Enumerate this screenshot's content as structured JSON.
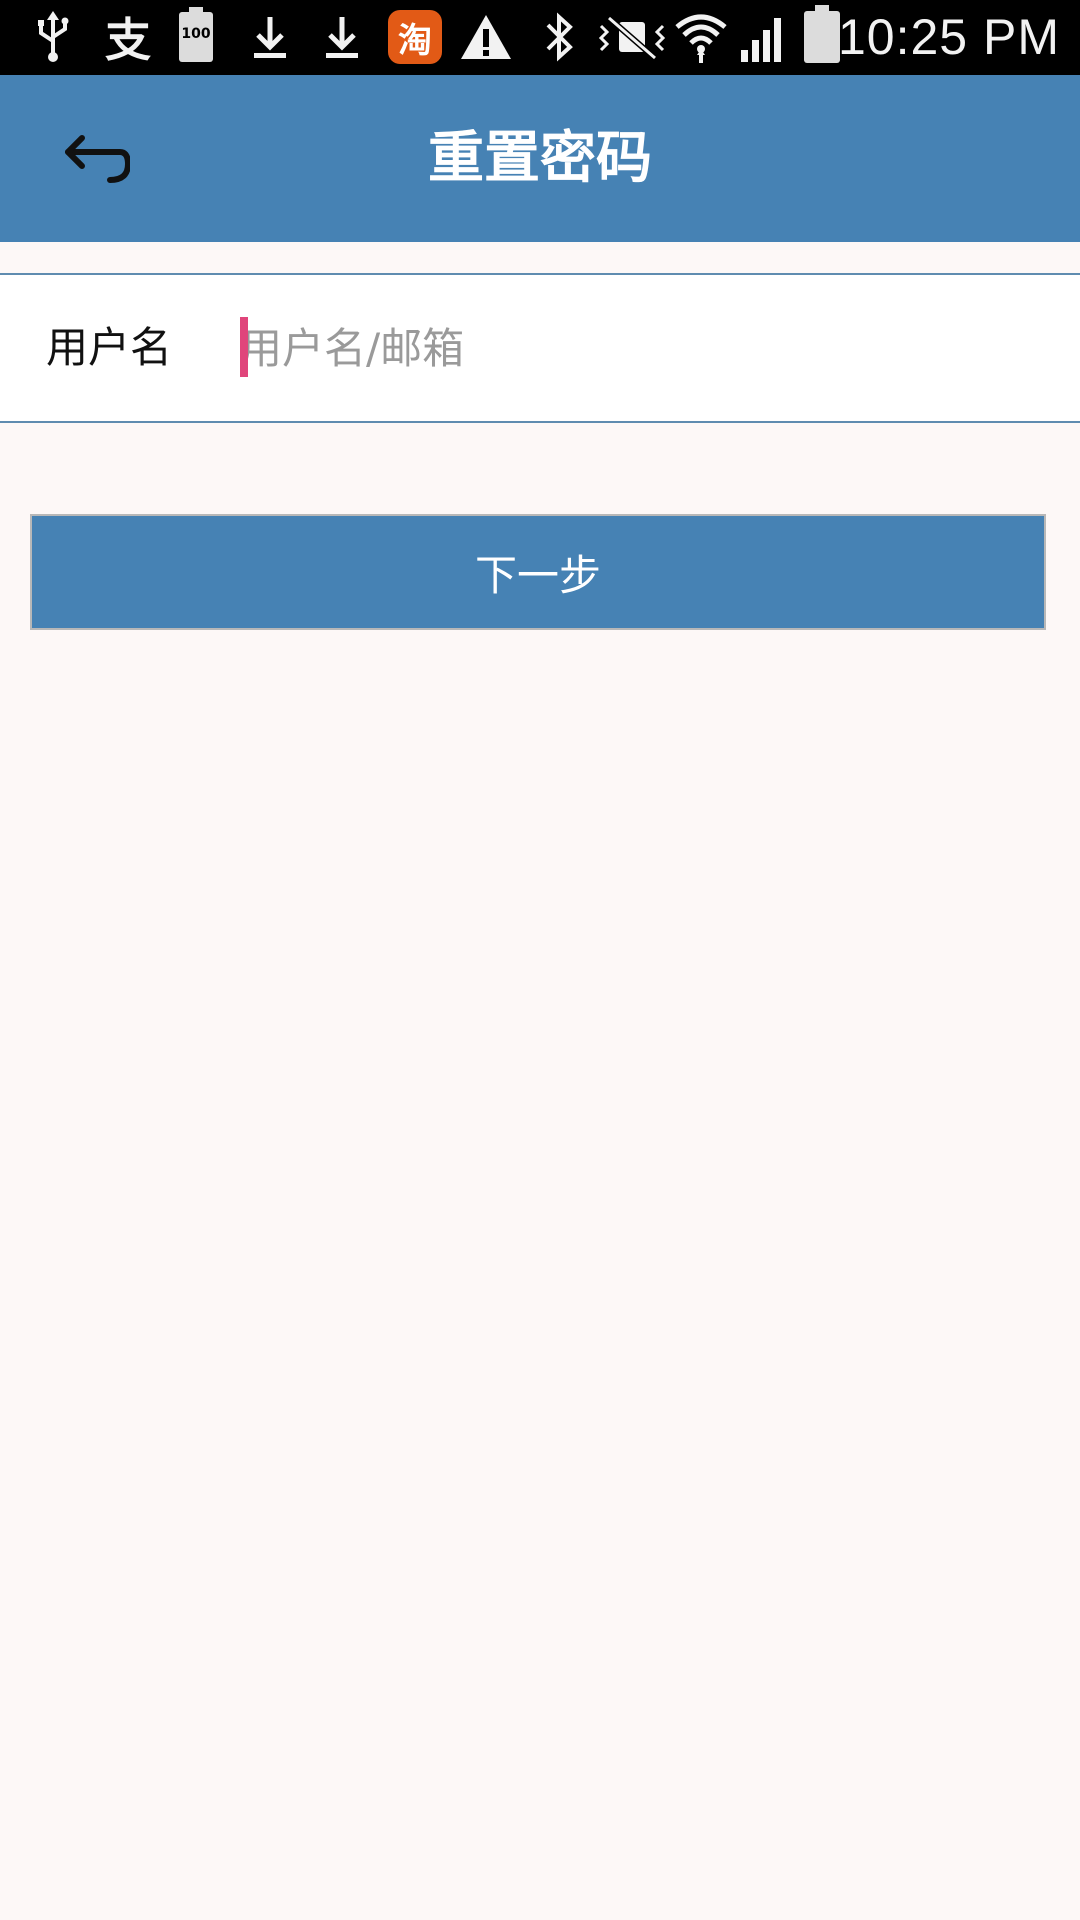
{
  "status_bar": {
    "time": "10:25 PM",
    "battery_level_text": "100",
    "taobao_glyph": "淘",
    "alipay_glyph": "支",
    "icons": [
      "usb-icon",
      "alipay-icon",
      "battery-100-icon",
      "download-icon",
      "download-icon",
      "taobao-icon",
      "warning-icon",
      "bluetooth-icon",
      "vibrate-icon",
      "wifi-icon",
      "signal-icon",
      "battery-icon"
    ]
  },
  "header": {
    "title": "重置密码",
    "back_icon": "back-arrow-icon",
    "background_color": "#4682b4"
  },
  "form": {
    "username_label": "用户名",
    "username_placeholder": "用户名/邮箱",
    "username_value": ""
  },
  "actions": {
    "next_label": "下一步",
    "button_color": "#4682b4"
  }
}
